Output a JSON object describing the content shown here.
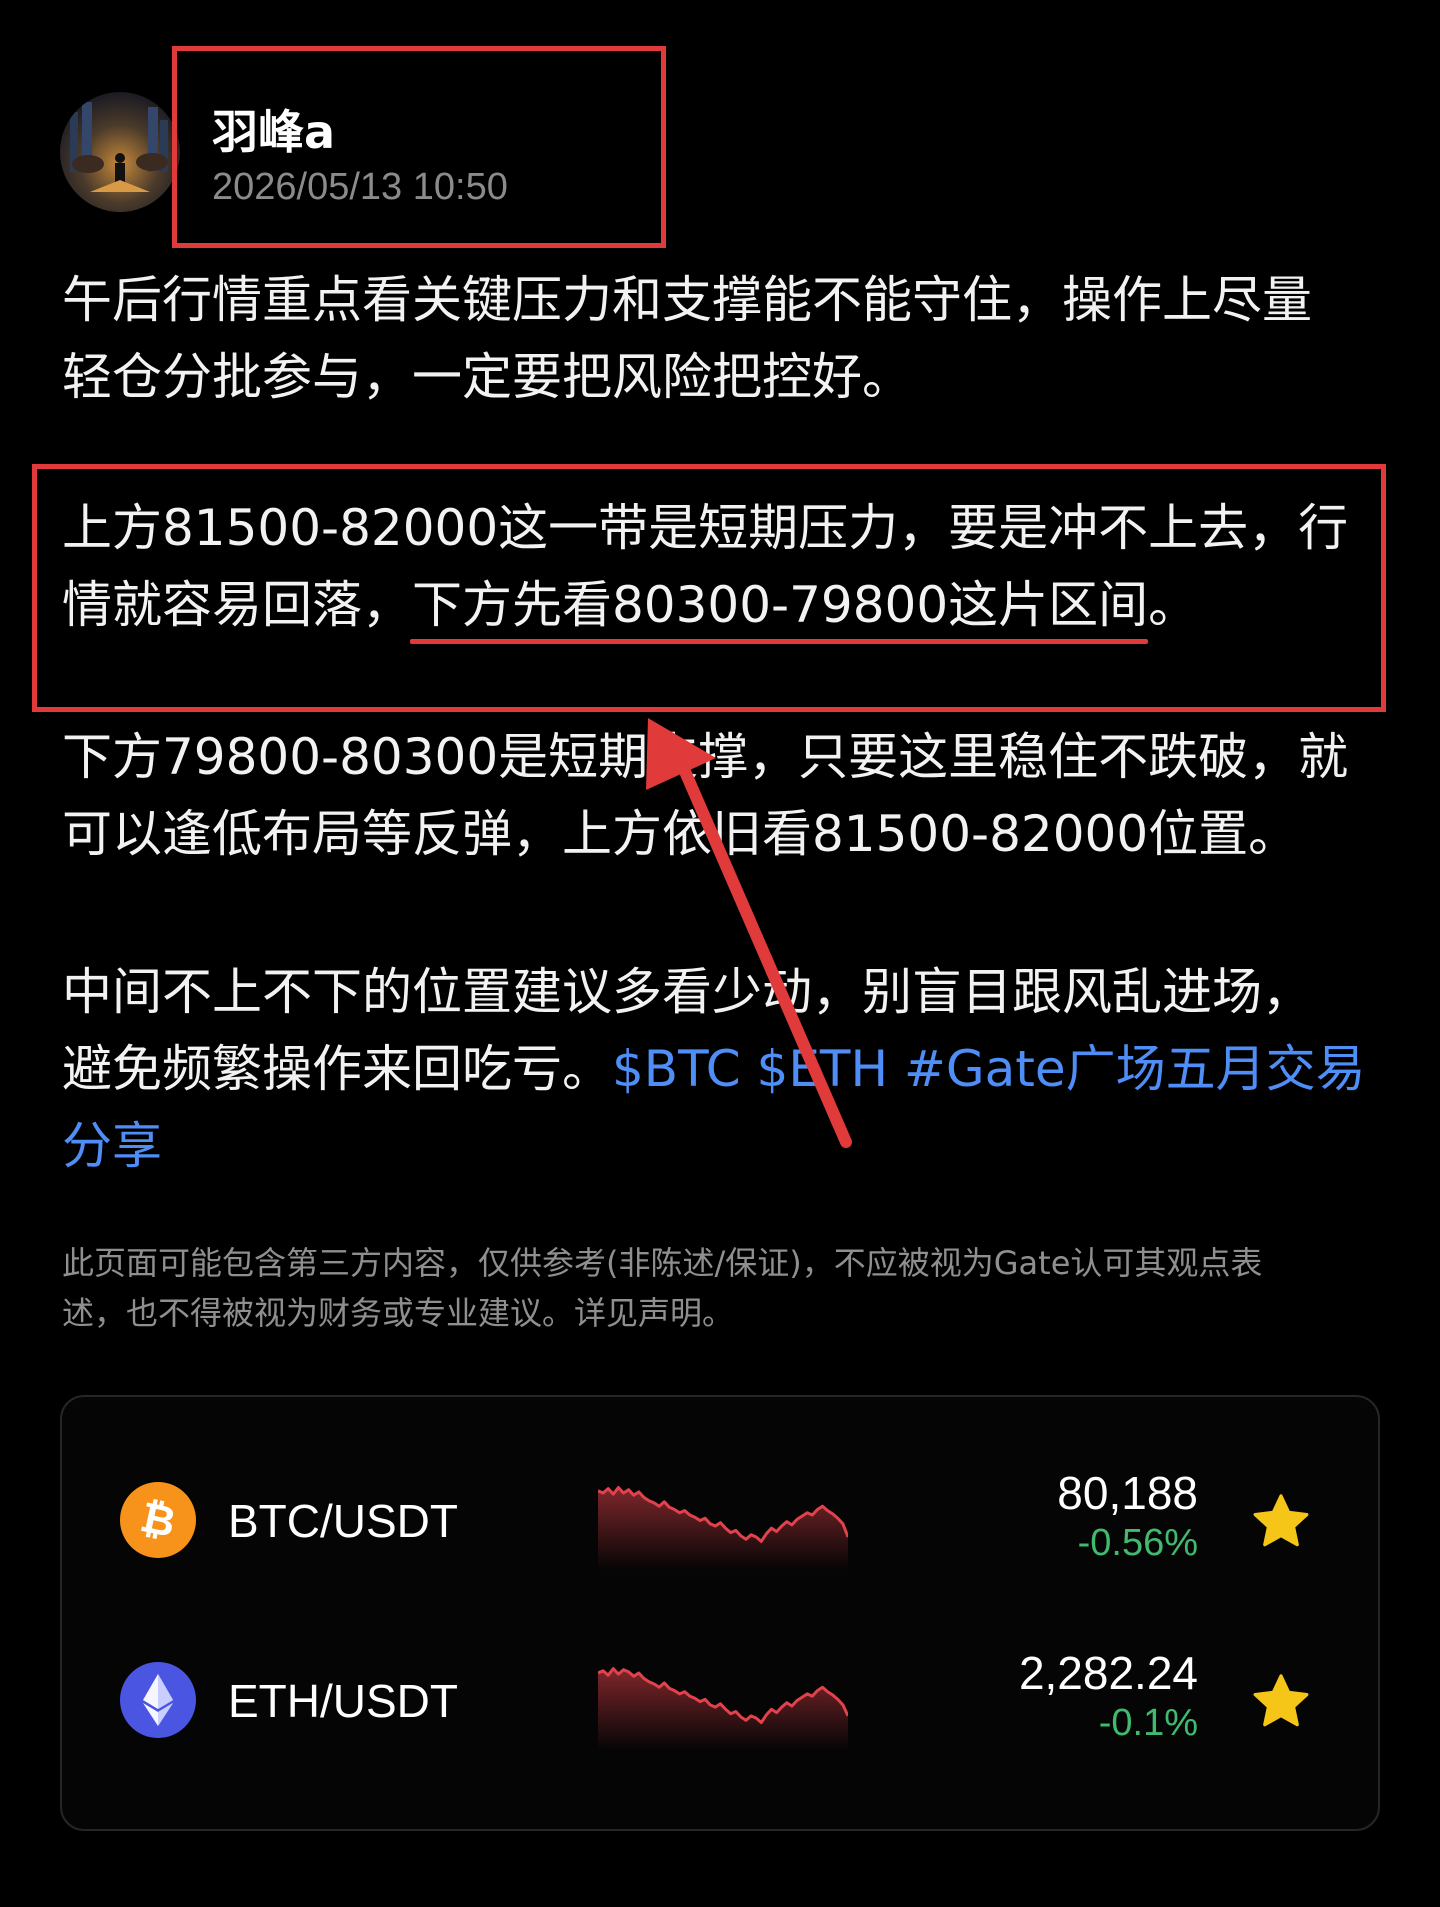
{
  "post": {
    "author": "羽峰a",
    "time": "2026/05/13 10:50",
    "p1": [
      "午后行情重点看关键压力和支撑能不能守住，操作上尽量",
      "轻仓分批参与，一定要把风险把控好。"
    ],
    "p2_line1": "上方81500-82000这一带是短期压力，要是冲不上去，行",
    "p2_line2_a": "情就容易回落，",
    "p2_line2_b": "下方先看80300-79800这片区间",
    "p2_line2_c": "。",
    "p3": [
      "下方79800-80300是短期支撑，只要这里稳住不跌破，就",
      "可以逢低布局等反弹，上方依旧看81500-82000位置。"
    ],
    "p4_line1": "中间不上不下的位置建议多看少动，别盲目跟风乱进场，",
    "p4_line2": "避免频繁操作来回吃亏。",
    "tags_line2": "$BTC $ETH #Gate广场五月交易",
    "tags_line3": "分享"
  },
  "disclaimer": [
    "此页面可能包含第三方内容，仅供参考(非陈述/保证)，不应被视为Gate认可其观点表",
    "述，也不得被视为财务或专业建议。详见声明。"
  ],
  "markets": [
    {
      "pair": "BTC/USDT",
      "price": "80,188",
      "change": "-0.56%",
      "icon": "bitcoin-icon",
      "icon_color": "#f7931a",
      "trend": [
        72,
        70,
        74,
        69,
        75,
        70,
        73,
        68,
        71,
        66,
        63,
        61,
        58,
        62,
        57,
        55,
        52,
        54,
        50,
        48,
        45,
        47,
        42,
        40,
        43,
        38,
        34,
        36,
        31,
        28,
        32,
        30,
        26,
        33,
        38,
        35,
        40,
        44,
        41,
        46,
        49,
        52,
        50,
        55,
        58,
        54,
        51,
        47,
        42,
        30
      ]
    },
    {
      "pair": "ETH/USDT",
      "price": "2,282.24",
      "change": "-0.1%",
      "icon": "ethereum-icon",
      "icon_color": "#4a56e2",
      "trend": [
        70,
        72,
        68,
        74,
        69,
        73,
        71,
        67,
        70,
        65,
        62,
        60,
        57,
        61,
        56,
        54,
        51,
        53,
        49,
        47,
        44,
        46,
        41,
        39,
        42,
        37,
        33,
        35,
        30,
        27,
        31,
        29,
        25,
        32,
        37,
        34,
        39,
        43,
        40,
        45,
        48,
        51,
        49,
        54,
        57,
        53,
        50,
        46,
        41,
        31
      ]
    }
  ],
  "colors": {
    "annotation": "#e03a3a",
    "tag": "#4f8ef7",
    "positive_change": "#3fba6f",
    "sparkline": "#e2424b",
    "star": "#f5c518"
  }
}
